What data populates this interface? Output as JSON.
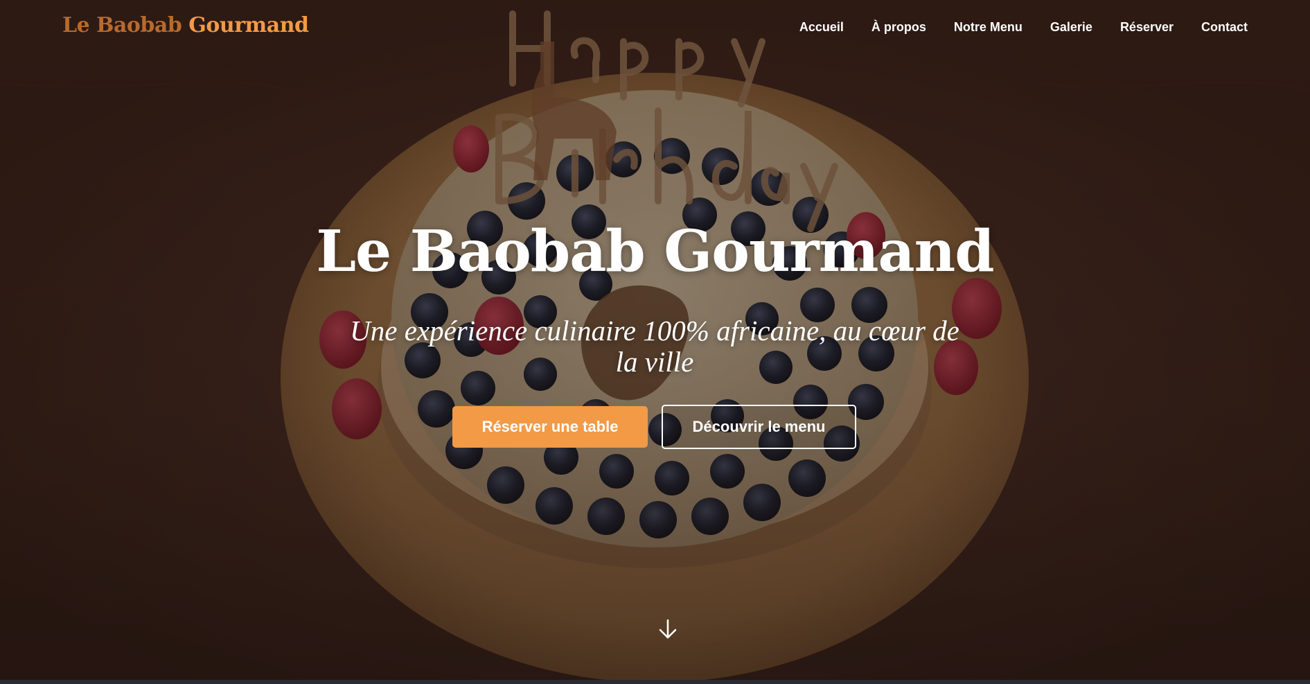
{
  "brand": {
    "name_part1": "Le Baobab",
    "name_part2": "Gourmand",
    "color_dark": "#b86a2d",
    "color_accent": "#f29a46"
  },
  "nav": {
    "items": [
      {
        "label": "Accueil"
      },
      {
        "label": "À propos"
      },
      {
        "label": "Notre Menu"
      },
      {
        "label": "Galerie"
      },
      {
        "label": "Réserver"
      },
      {
        "label": "Contact"
      }
    ]
  },
  "hero": {
    "title": "Le Baobab Gourmand",
    "subtitle": "Une expérience culinaire 100% africaine, au cœur de la ville",
    "primary_button": "Réserver une table",
    "secondary_button": "Découvrir le menu",
    "scroll_icon": "arrow-down-icon",
    "background_image": "birthday cake with blueberries and raspberries on a wooden board",
    "cake_topper_text": "Happy Birthday"
  },
  "colors": {
    "accent": "#f29a46",
    "text": "#ffffff"
  }
}
